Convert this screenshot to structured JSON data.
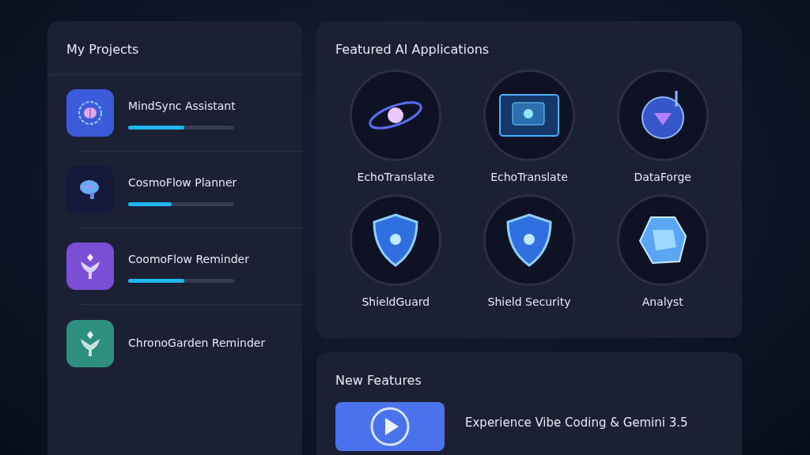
{
  "projects": {
    "title": "My Projects",
    "items": [
      {
        "name": "MindSync Assistant",
        "kind": "gear-brain",
        "color": "#3b5bdb",
        "level": 0.53
      },
      {
        "name": "CosmoFlow Planner",
        "kind": "brain",
        "color": "#151a3a",
        "level": 0.41
      },
      {
        "name": "CoomoFlow Reminder",
        "kind": "sprout",
        "color": "#7a4fd6",
        "level": 0.53
      },
      {
        "name": "ChronoGarden Reminder",
        "kind": "sprout",
        "color": "#2f8f7e"
      }
    ]
  },
  "featured": {
    "title": "Featured AI Applications",
    "apps": [
      {
        "name": "EchoTranslate",
        "kind": "galaxy"
      },
      {
        "name": "EchoTranslate",
        "kind": "screen"
      },
      {
        "name": "DataForge",
        "kind": "sphere"
      },
      {
        "name": "ShieldGuard",
        "kind": "shield"
      },
      {
        "name": "Shield Security",
        "kind": "shield"
      },
      {
        "name": "Analyst",
        "kind": "crystal"
      }
    ]
  },
  "new_features": {
    "title": "New Features",
    "items": [
      {
        "title": "Experience Vibe Coding & Gemini 3.5",
        "kind": "video"
      }
    ]
  }
}
